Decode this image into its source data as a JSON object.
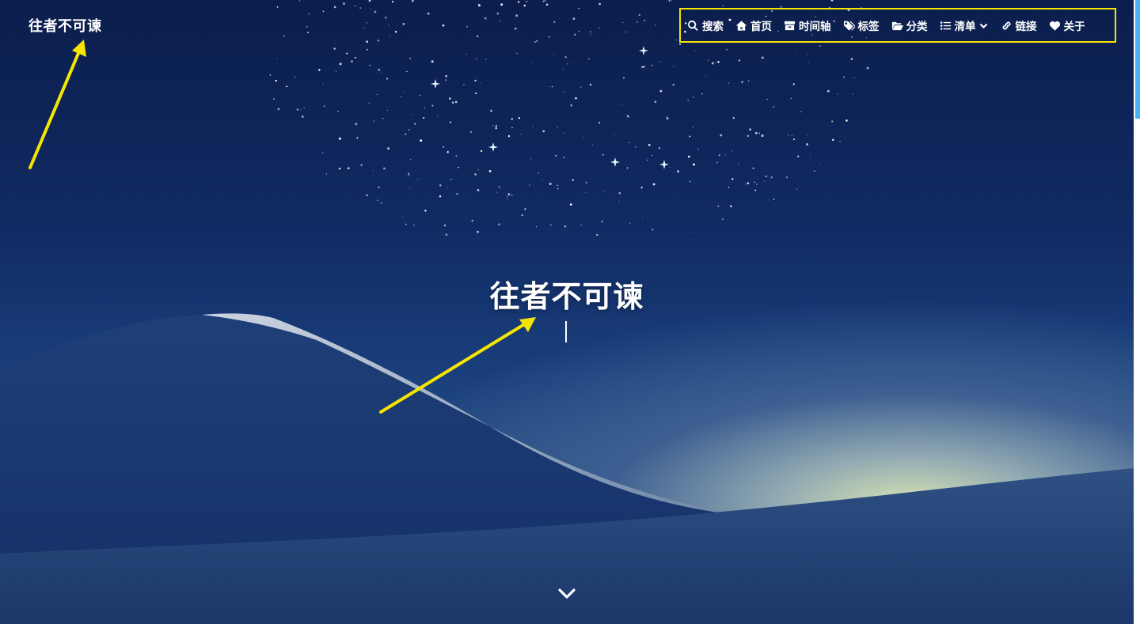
{
  "site": {
    "brand": "往者不可谏"
  },
  "nav": {
    "items": [
      {
        "label": "搜索",
        "icon": "search-icon"
      },
      {
        "label": "首页",
        "icon": "home-icon"
      },
      {
        "label": "时间轴",
        "icon": "archive-icon"
      },
      {
        "label": "标签",
        "icon": "tags-icon"
      },
      {
        "label": "分类",
        "icon": "folder-open-icon"
      },
      {
        "label": "清单",
        "icon": "list-icon"
      },
      {
        "label": "链接",
        "icon": "link-icon"
      },
      {
        "label": "关于",
        "icon": "heart-icon"
      }
    ],
    "highlight_color": "#f5e500"
  },
  "hero": {
    "title": "往者不可谏"
  },
  "colors": {
    "annotation": "#f5e500",
    "text": "#ffffff",
    "scrollbar_thumb": "#49b1f5"
  }
}
